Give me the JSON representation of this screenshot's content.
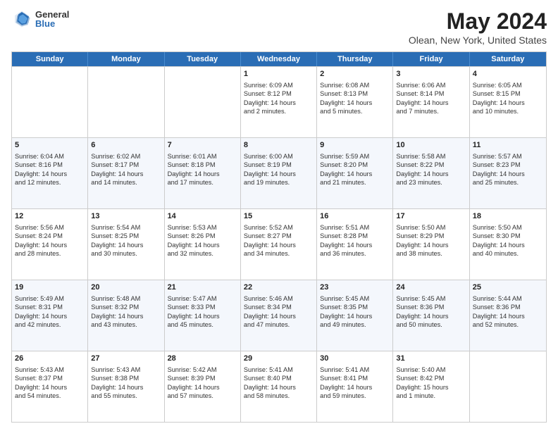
{
  "header": {
    "logo_general": "General",
    "logo_blue": "Blue",
    "title": "May 2024",
    "location": "Olean, New York, United States"
  },
  "weekdays": [
    "Sunday",
    "Monday",
    "Tuesday",
    "Wednesday",
    "Thursday",
    "Friday",
    "Saturday"
  ],
  "rows": [
    [
      {
        "day": "",
        "text": ""
      },
      {
        "day": "",
        "text": ""
      },
      {
        "day": "",
        "text": ""
      },
      {
        "day": "1",
        "text": "Sunrise: 6:09 AM\nSunset: 8:12 PM\nDaylight: 14 hours\nand 2 minutes."
      },
      {
        "day": "2",
        "text": "Sunrise: 6:08 AM\nSunset: 8:13 PM\nDaylight: 14 hours\nand 5 minutes."
      },
      {
        "day": "3",
        "text": "Sunrise: 6:06 AM\nSunset: 8:14 PM\nDaylight: 14 hours\nand 7 minutes."
      },
      {
        "day": "4",
        "text": "Sunrise: 6:05 AM\nSunset: 8:15 PM\nDaylight: 14 hours\nand 10 minutes."
      }
    ],
    [
      {
        "day": "5",
        "text": "Sunrise: 6:04 AM\nSunset: 8:16 PM\nDaylight: 14 hours\nand 12 minutes."
      },
      {
        "day": "6",
        "text": "Sunrise: 6:02 AM\nSunset: 8:17 PM\nDaylight: 14 hours\nand 14 minutes."
      },
      {
        "day": "7",
        "text": "Sunrise: 6:01 AM\nSunset: 8:18 PM\nDaylight: 14 hours\nand 17 minutes."
      },
      {
        "day": "8",
        "text": "Sunrise: 6:00 AM\nSunset: 8:19 PM\nDaylight: 14 hours\nand 19 minutes."
      },
      {
        "day": "9",
        "text": "Sunrise: 5:59 AM\nSunset: 8:20 PM\nDaylight: 14 hours\nand 21 minutes."
      },
      {
        "day": "10",
        "text": "Sunrise: 5:58 AM\nSunset: 8:22 PM\nDaylight: 14 hours\nand 23 minutes."
      },
      {
        "day": "11",
        "text": "Sunrise: 5:57 AM\nSunset: 8:23 PM\nDaylight: 14 hours\nand 25 minutes."
      }
    ],
    [
      {
        "day": "12",
        "text": "Sunrise: 5:56 AM\nSunset: 8:24 PM\nDaylight: 14 hours\nand 28 minutes."
      },
      {
        "day": "13",
        "text": "Sunrise: 5:54 AM\nSunset: 8:25 PM\nDaylight: 14 hours\nand 30 minutes."
      },
      {
        "day": "14",
        "text": "Sunrise: 5:53 AM\nSunset: 8:26 PM\nDaylight: 14 hours\nand 32 minutes."
      },
      {
        "day": "15",
        "text": "Sunrise: 5:52 AM\nSunset: 8:27 PM\nDaylight: 14 hours\nand 34 minutes."
      },
      {
        "day": "16",
        "text": "Sunrise: 5:51 AM\nSunset: 8:28 PM\nDaylight: 14 hours\nand 36 minutes."
      },
      {
        "day": "17",
        "text": "Sunrise: 5:50 AM\nSunset: 8:29 PM\nDaylight: 14 hours\nand 38 minutes."
      },
      {
        "day": "18",
        "text": "Sunrise: 5:50 AM\nSunset: 8:30 PM\nDaylight: 14 hours\nand 40 minutes."
      }
    ],
    [
      {
        "day": "19",
        "text": "Sunrise: 5:49 AM\nSunset: 8:31 PM\nDaylight: 14 hours\nand 42 minutes."
      },
      {
        "day": "20",
        "text": "Sunrise: 5:48 AM\nSunset: 8:32 PM\nDaylight: 14 hours\nand 43 minutes."
      },
      {
        "day": "21",
        "text": "Sunrise: 5:47 AM\nSunset: 8:33 PM\nDaylight: 14 hours\nand 45 minutes."
      },
      {
        "day": "22",
        "text": "Sunrise: 5:46 AM\nSunset: 8:34 PM\nDaylight: 14 hours\nand 47 minutes."
      },
      {
        "day": "23",
        "text": "Sunrise: 5:45 AM\nSunset: 8:35 PM\nDaylight: 14 hours\nand 49 minutes."
      },
      {
        "day": "24",
        "text": "Sunrise: 5:45 AM\nSunset: 8:36 PM\nDaylight: 14 hours\nand 50 minutes."
      },
      {
        "day": "25",
        "text": "Sunrise: 5:44 AM\nSunset: 8:36 PM\nDaylight: 14 hours\nand 52 minutes."
      }
    ],
    [
      {
        "day": "26",
        "text": "Sunrise: 5:43 AM\nSunset: 8:37 PM\nDaylight: 14 hours\nand 54 minutes."
      },
      {
        "day": "27",
        "text": "Sunrise: 5:43 AM\nSunset: 8:38 PM\nDaylight: 14 hours\nand 55 minutes."
      },
      {
        "day": "28",
        "text": "Sunrise: 5:42 AM\nSunset: 8:39 PM\nDaylight: 14 hours\nand 57 minutes."
      },
      {
        "day": "29",
        "text": "Sunrise: 5:41 AM\nSunset: 8:40 PM\nDaylight: 14 hours\nand 58 minutes."
      },
      {
        "day": "30",
        "text": "Sunrise: 5:41 AM\nSunset: 8:41 PM\nDaylight: 14 hours\nand 59 minutes."
      },
      {
        "day": "31",
        "text": "Sunrise: 5:40 AM\nSunset: 8:42 PM\nDaylight: 15 hours\nand 1 minute."
      },
      {
        "day": "",
        "text": ""
      }
    ]
  ]
}
